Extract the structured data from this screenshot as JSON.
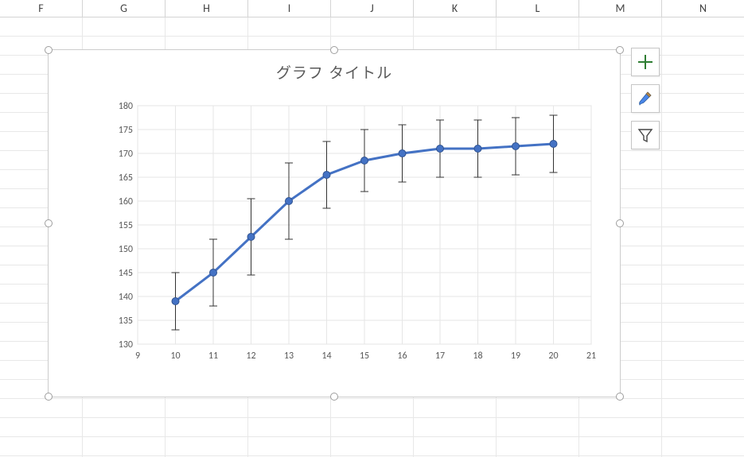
{
  "columns": [
    "F",
    "G",
    "H",
    "I",
    "J",
    "K",
    "L",
    "M",
    "N"
  ],
  "chart_data": {
    "type": "line",
    "title": "グラフ タイトル",
    "xlabel": "",
    "ylabel": "",
    "x": [
      10,
      11,
      12,
      13,
      14,
      15,
      16,
      17,
      18,
      19,
      20
    ],
    "y": [
      139,
      145,
      152.5,
      160,
      165.5,
      168.5,
      170,
      171,
      171,
      171.5,
      172
    ],
    "error_bars": {
      "lower": [
        6,
        7,
        8,
        8,
        7,
        6.5,
        6,
        6,
        6,
        6,
        6
      ],
      "upper": [
        6,
        7,
        8,
        8,
        7,
        6.5,
        6,
        6,
        6,
        6,
        6
      ]
    },
    "xlim": [
      9,
      21
    ],
    "ylim": [
      130,
      180
    ],
    "xticks": [
      9,
      10,
      11,
      12,
      13,
      14,
      15,
      16,
      17,
      18,
      19,
      20,
      21
    ],
    "yticks": [
      130,
      135,
      140,
      145,
      150,
      155,
      160,
      165,
      170,
      175,
      180
    ],
    "grid": true,
    "line_color": "#4472C4",
    "marker_color": "#4472C4"
  },
  "action_labels": {
    "elements": "Chart Elements",
    "styles": "Chart Styles",
    "filters": "Chart Filters"
  }
}
